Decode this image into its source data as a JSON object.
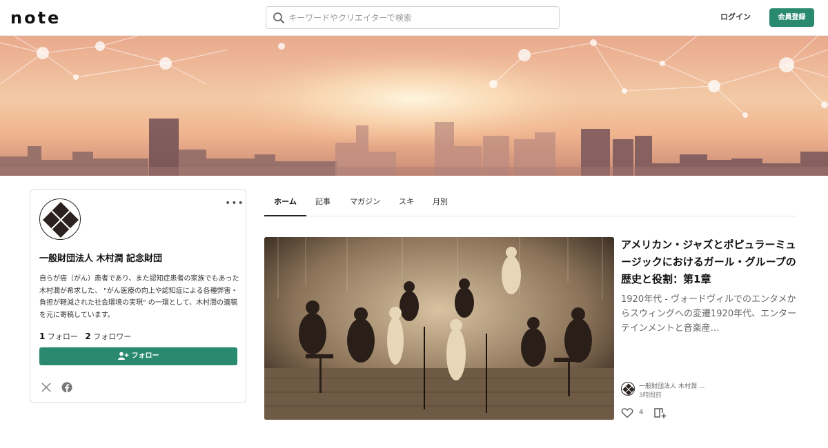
{
  "header": {
    "logo": "note",
    "search_placeholder": "キーワードやクリエイターで検索",
    "login_label": "ログイン",
    "signup_label": "会員登録",
    "accent_color": "#2a8a70"
  },
  "profile": {
    "name": "一般財団法人 木村潤 記念財団",
    "bio": "自らが癌（がん）患者であり、また認知症患者の家族でもあった木村潤が希求した、 \"がん医療の向上や認知症による各種弊害・負担が軽減された社会環境の実現\" の一環として、木村潤の遺稿を元に寄稿しています。",
    "following_count": "1",
    "following_label": "フォロー",
    "followers_count": "2",
    "followers_label": "フォロワー",
    "follow_button_label": "フォロー",
    "more_label": "•••"
  },
  "tabs": [
    {
      "label": "ホーム",
      "active": true
    },
    {
      "label": "記事",
      "active": false
    },
    {
      "label": "マガジン",
      "active": false
    },
    {
      "label": "スキ",
      "active": false
    },
    {
      "label": "月別",
      "active": false
    }
  ],
  "article": {
    "title": "アメリカン・ジャズとポピュラーミュージックにおけるガール・グループの歴史と役割：第1章",
    "excerpt": "1920年代 - ヴォードヴィルでのエンタメからスウィングへの変遷1920年代、エンターテインメントと音楽産…",
    "author": "一般財団法人 木村潤 ...",
    "time": "3時間前",
    "likes": "4"
  }
}
